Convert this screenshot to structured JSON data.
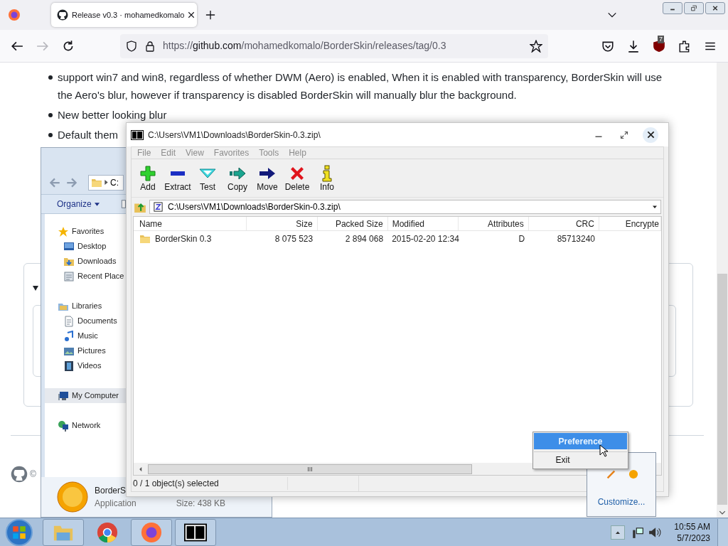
{
  "browser": {
    "tab": {
      "title": "Release v0.3 · mohamedkomalo",
      "selected": true
    },
    "url": {
      "scheme": "https://",
      "host": "github.com",
      "path": "/mohamedkomalo/BorderSkin/releases/tag/0.3"
    },
    "extension_badge": "7"
  },
  "page": {
    "bullets": [
      "support win7 and win8, regardless of whether DWM (Aero) is enabled, When it is enabled with transparency, BorderSkin will use the Aero's blur, however if transparency is disabled BorderSkin will manually blur the background.",
      "New better looking blur",
      "Default them"
    ],
    "footer": "©"
  },
  "explorer": {
    "breadcrumb": "C:",
    "organize": "Organize",
    "nav": [
      {
        "label": "Favorites",
        "selected": false,
        "children": [
          {
            "label": "Desktop",
            "selected": false
          },
          {
            "label": "Downloads",
            "selected": false
          },
          {
            "label": "Recent Place",
            "selected": false
          }
        ]
      },
      {
        "label": "Libraries",
        "selected": false,
        "children": [
          {
            "label": "Documents",
            "selected": false
          },
          {
            "label": "Music",
            "selected": false
          },
          {
            "label": "Pictures",
            "selected": false
          },
          {
            "label": "Videos",
            "selected": false
          }
        ]
      },
      {
        "label": "My Computer",
        "selected": true
      },
      {
        "label": "Network",
        "selected": false
      }
    ],
    "details": {
      "name": "BorderS",
      "type": "Application",
      "size": "Size: 438 KB"
    }
  },
  "sevenzip": {
    "title": "C:\\Users\\VM1\\Downloads\\BorderSkin-0.3.zip\\",
    "menu": [
      "File",
      "Edit",
      "View",
      "Favorites",
      "Tools",
      "Help"
    ],
    "toolbar": [
      "Add",
      "Extract",
      "Test",
      "Copy",
      "Move",
      "Delete",
      "Info"
    ],
    "path": "C:\\Users\\VM1\\Downloads\\BorderSkin-0.3.zip\\",
    "columns": [
      "Name",
      "Size",
      "Packed Size",
      "Modified",
      "Attributes",
      "CRC",
      "Encrypte"
    ],
    "rows": [
      [
        "BorderSkin 0.3",
        "8 075 523",
        "2 894 068",
        "2015-02-20 12:34",
        "D",
        "85713240",
        ""
      ]
    ],
    "status": "0 / 1 object(s) selected"
  },
  "context_menu": [
    {
      "label": "Preference",
      "selected": true
    },
    {
      "label": "Exit",
      "selected": false
    }
  ],
  "tray_popup": {
    "link": "Customize..."
  },
  "taskbar": {
    "time": "10:55 AM",
    "date": "5/7/2023"
  }
}
